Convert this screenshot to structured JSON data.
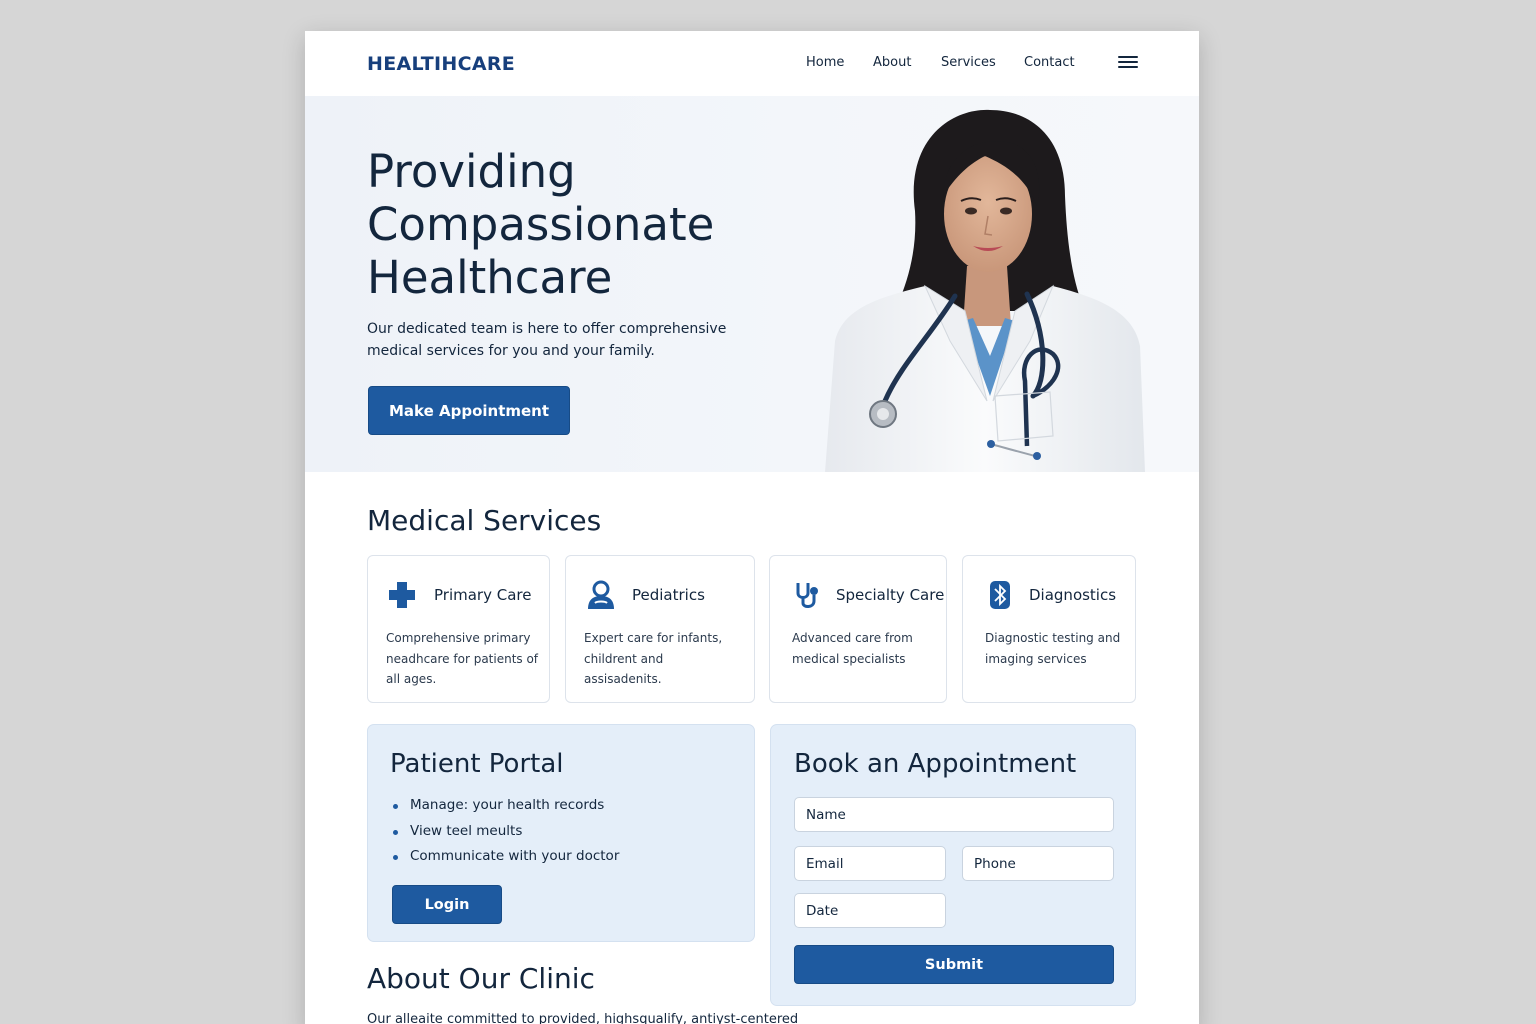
{
  "header": {
    "logo": "HEALTIHCARE",
    "nav": [
      "Home",
      "About",
      "Services",
      "Contact"
    ],
    "menu_icon": "hamburger-menu-icon"
  },
  "hero": {
    "title": "Providing Compassionate Healthcare",
    "subtitle": "Our dedicated team is here to offer comprehensive medical services for you and your family.",
    "button": "Make Appointment"
  },
  "services": {
    "title": "Medical Services",
    "items": [
      {
        "icon": "medical-cross-icon",
        "title": "Primary Care",
        "description": "Comprehensive primary neadhcare for patients of all ages."
      },
      {
        "icon": "user-group-icon",
        "title": "Pediatrics",
        "description": "Expert care for infants, childrent and assisadenits."
      },
      {
        "icon": "stethoscope-icon",
        "title": "Specialty Care",
        "description": "Advanced care from medical specialists"
      },
      {
        "icon": "bluetooth-icon",
        "title": "Diagnostics",
        "description": "Diagnostic testing and imaging services"
      }
    ]
  },
  "portal": {
    "title": "Patient Portal",
    "items": [
      "Manage: your health records",
      "View teel meults",
      "Communicate with your doctor"
    ],
    "button": "Login"
  },
  "booking": {
    "title": "Book an Appointment",
    "placeholders": {
      "name": "Name",
      "email": "Email",
      "phone": "Phone",
      "date": "Date"
    },
    "button": "Submit"
  },
  "about": {
    "title": "About Our Clinic",
    "text": "Our alleaite committed to provided, highsqualify, antiyst-centered"
  },
  "colors": {
    "primary": "#1e5aa0",
    "heading": "#13263d",
    "logo": "#173f7c",
    "panel": "#e4eef9",
    "page_bg": "#d6d6d6"
  }
}
